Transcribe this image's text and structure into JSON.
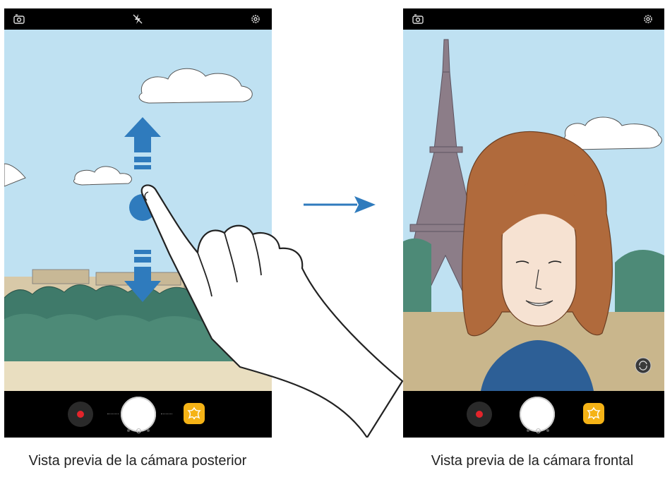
{
  "captions": {
    "rear": "Vista previa de la cámara posterior",
    "front": "Vista previa de la cámara frontal"
  },
  "icons": {
    "switch_camera": "switch-camera-icon",
    "flash": "flash-off-icon",
    "settings": "gear-icon",
    "record": "record-icon",
    "shutter": "shutter-button",
    "effects": "effects-icon",
    "swap": "camera-swap-icon"
  },
  "colors": {
    "sky": "#bfe1f2",
    "record": "#e3242b",
    "effects": "#f5b316",
    "gesture_arrow": "#2f7bbd"
  }
}
